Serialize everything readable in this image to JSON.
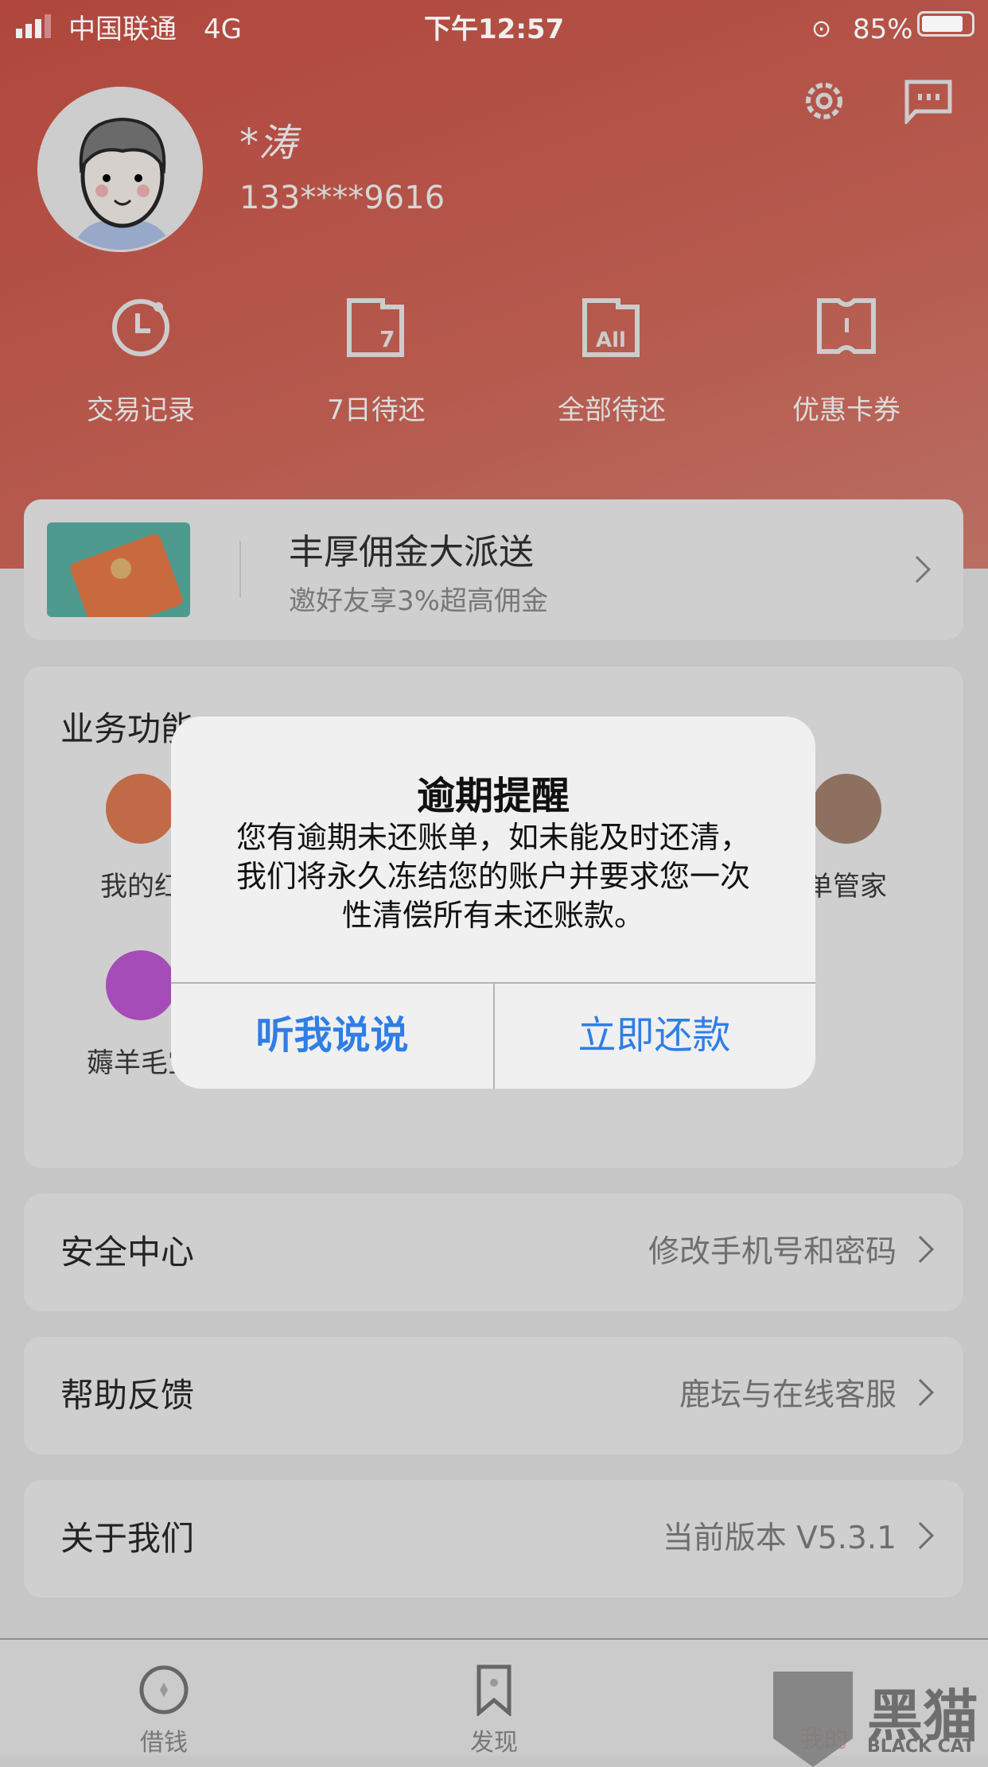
{
  "status_bar": {
    "carrier": "中国联通",
    "network": "4G",
    "time": "下午12:57",
    "battery": "85%"
  },
  "profile": {
    "name": "*涛",
    "phone": "133****9616"
  },
  "header_icons": [
    "gear-icon",
    "message-icon"
  ],
  "quick_actions": [
    {
      "label": "交易记录",
      "icon": "clock-icon"
    },
    {
      "label": "7日待还",
      "icon": "calendar-7-icon",
      "badge": "7"
    },
    {
      "label": "全部待还",
      "icon": "calendar-all-icon",
      "badge": "All"
    },
    {
      "label": "优惠卡券",
      "icon": "ticket-icon"
    }
  ],
  "banner": {
    "title": "丰厚佣金大派送",
    "subtitle": "邀好友享3%超高佣金"
  },
  "business": {
    "title": "业务功能",
    "items": [
      {
        "label": "我的红",
        "color": "#c06a48"
      },
      {
        "label": "单管家",
        "color": "#8e7060"
      },
      {
        "label": "薅羊毛宝",
        "color": "#a64cb8"
      }
    ]
  },
  "rows": [
    {
      "label": "安全中心",
      "value": "修改手机号和密码"
    },
    {
      "label": "帮助反馈",
      "value": "鹿坛与在线客服"
    },
    {
      "label": "关于我们",
      "value": "当前版本 V5.3.1"
    }
  ],
  "tabs": [
    {
      "label": "借钱"
    },
    {
      "label": "发现"
    },
    {
      "label": "我的"
    }
  ],
  "dialog": {
    "title": "逾期提醒",
    "lines": [
      "您有逾期未还账单，如未能及时还清，",
      "我们将永久冻结您的账户并要求您一次",
      "性清偿所有未还账款。"
    ],
    "cancel": "听我说说",
    "confirm": "立即还款",
    "accent": "#2f7ee6"
  },
  "watermark": {
    "text": "黑猫",
    "subtext": "BLACK CAT"
  }
}
